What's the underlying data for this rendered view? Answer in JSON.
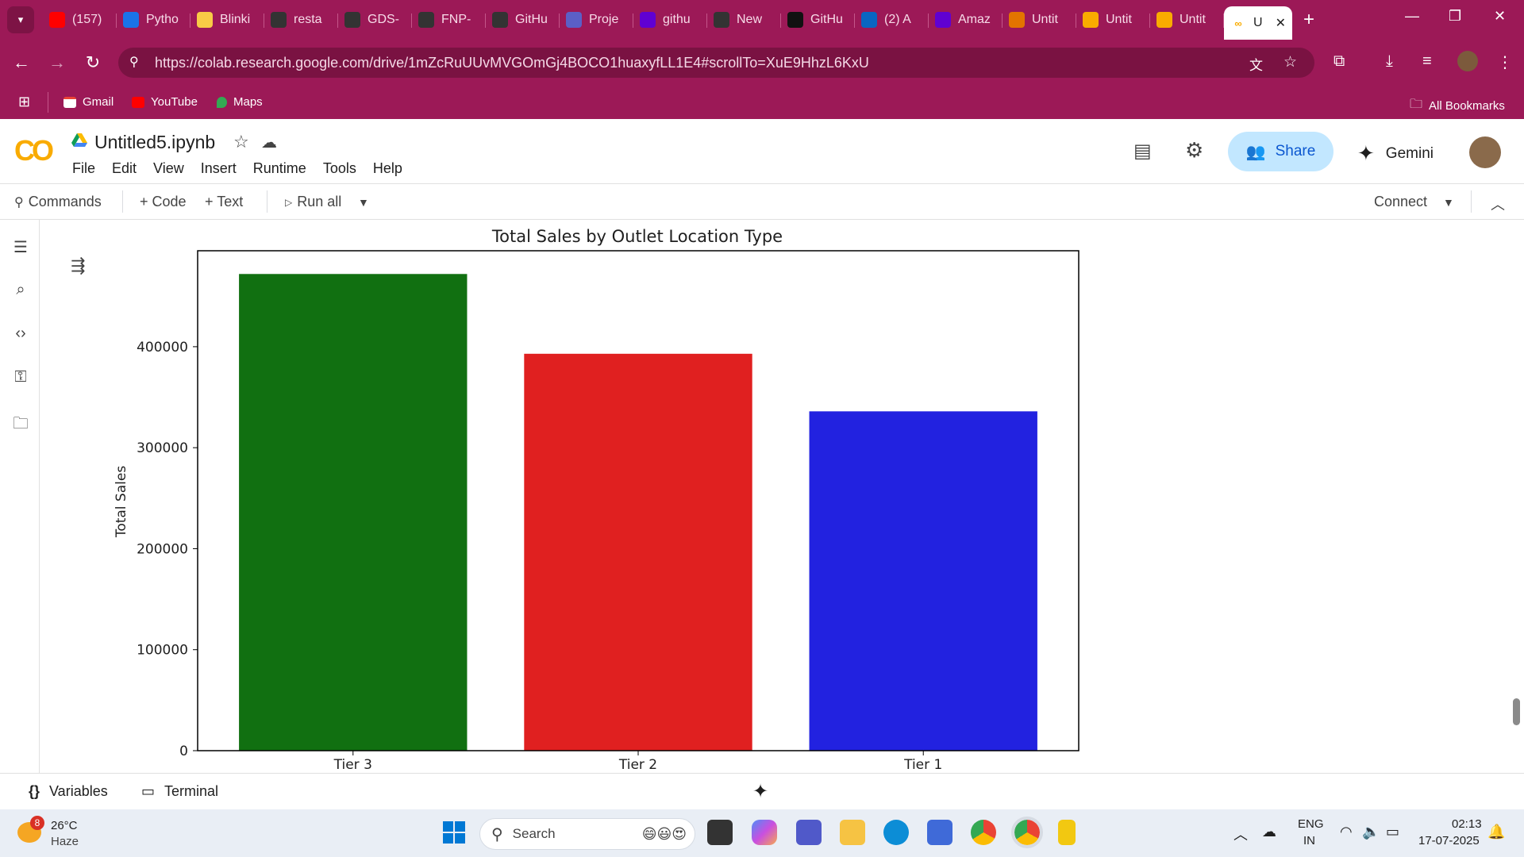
{
  "browser": {
    "tabs": [
      {
        "label": "(157)",
        "icon": "youtube-icon",
        "color": "#ff0000"
      },
      {
        "label": "Pytho",
        "icon": "drive-icon",
        "color": "#1a73e8"
      },
      {
        "label": "Blinki",
        "icon": "blinkit-icon",
        "color": "#f8cb46"
      },
      {
        "label": "resta",
        "icon": "github-icon",
        "color": "#333333"
      },
      {
        "label": "GDS-",
        "icon": "github-icon",
        "color": "#333333"
      },
      {
        "label": "FNP-",
        "icon": "github-icon",
        "color": "#333333"
      },
      {
        "label": "GitHu",
        "icon": "github-icon",
        "color": "#333333"
      },
      {
        "label": "Proje",
        "icon": "project-icon",
        "color": "#5b5fc7"
      },
      {
        "label": "githu",
        "icon": "yahoo-icon",
        "color": "#6001d2"
      },
      {
        "label": "New",
        "icon": "github-icon",
        "color": "#333333"
      },
      {
        "label": "GitHu",
        "icon": "chatgpt-icon",
        "color": "#111111"
      },
      {
        "label": "(2) A",
        "icon": "linkedin-icon",
        "color": "#0a66c2"
      },
      {
        "label": "Amaz",
        "icon": "yahoo-icon",
        "color": "#6001d2"
      },
      {
        "label": "Untit",
        "icon": "colab-icon",
        "color": "#e37400"
      },
      {
        "label": "Untit",
        "icon": "colab-icon",
        "color": "#f9ab00"
      },
      {
        "label": "Untit",
        "icon": "colab-icon",
        "color": "#f9ab00"
      }
    ],
    "active_tab": {
      "label": "U",
      "icon": "colab-icon"
    },
    "url": "https://colab.research.google.com/drive/1mZcRuUUvMVGOmGj4BOCO1huaxyfLL1E4#scrollTo=XuE9HhzL6KxU",
    "bookmarks": [
      "Gmail",
      "YouTube",
      "Maps"
    ],
    "all_bookmarks": "All Bookmarks",
    "accent": "#9c1957"
  },
  "colab": {
    "notebook_title": "Untitled5.ipynb",
    "menu": [
      "File",
      "Edit",
      "View",
      "Insert",
      "Runtime",
      "Tools",
      "Help"
    ],
    "share_label": "Share",
    "gemini_label": "Gemini",
    "toolbar": {
      "commands": "Commands",
      "code": "+ Code",
      "text": "+ Text",
      "run_all": "Run all",
      "connect": "Connect"
    },
    "bottom": {
      "variables": "Variables",
      "terminal": "Terminal"
    }
  },
  "chart_data": {
    "type": "bar",
    "title": "Total Sales by Outlet Location Type",
    "xlabel": "",
    "ylabel": "Total Sales",
    "categories": [
      "Tier 3",
      "Tier 2",
      "Tier 1"
    ],
    "values": [
      472000,
      393000,
      336000
    ],
    "colors": [
      "#117011",
      "#e02020",
      "#2222e0"
    ],
    "yticks": [
      0,
      100000,
      200000,
      300000,
      400000
    ],
    "ytick_labels": [
      "0",
      "100000",
      "200000",
      "300000",
      "400000"
    ],
    "ylim": [
      0,
      495000
    ],
    "grid": false,
    "legend": "none"
  },
  "taskbar": {
    "weather_temp": "26°C",
    "weather_desc": "Haze",
    "weather_badge": "8",
    "search_placeholder": "Search",
    "lang_line1": "ENG",
    "lang_line2": "IN",
    "time": "02:13",
    "date": "17-07-2025"
  }
}
